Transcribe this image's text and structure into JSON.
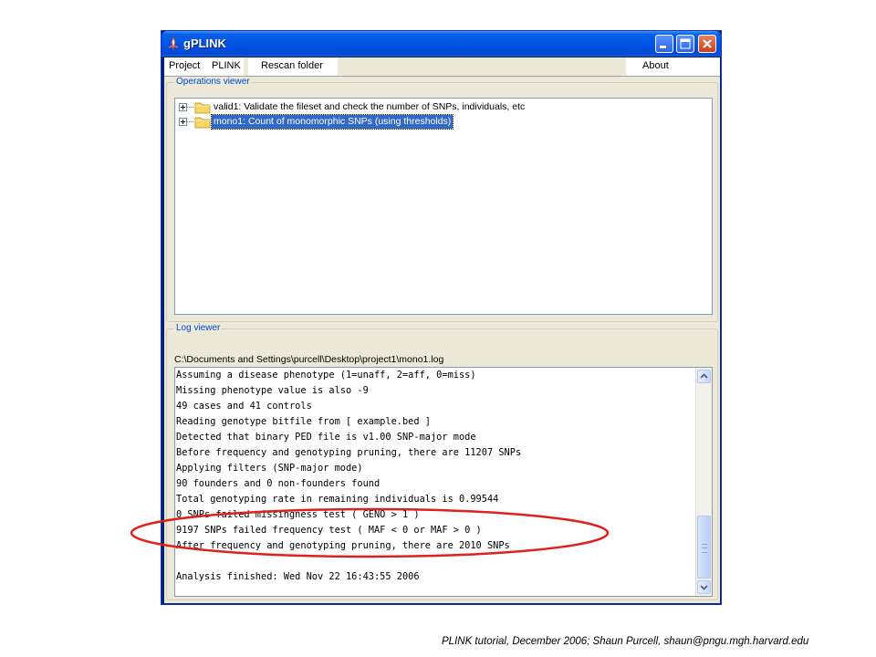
{
  "window": {
    "title": "gPLINK"
  },
  "menu": {
    "project": "Project",
    "plink": "PLINK",
    "rescan": "Rescan folder",
    "about": "About"
  },
  "operations": {
    "label": "Operations viewer",
    "items": [
      {
        "label": "valid1: Validate the fileset and check the number of SNPs, individuals, etc",
        "selected": false
      },
      {
        "label": "mono1: Count of monomorphic SNPs (using thresholds)",
        "selected": true
      }
    ]
  },
  "log": {
    "label": "Log viewer",
    "path": "C:\\Documents and Settings\\purcell\\Desktop\\project1\\mono1.log",
    "lines": [
      "Assuming a disease phenotype (1=unaff, 2=aff, 0=miss)",
      "Missing phenotype value is also -9",
      "49 cases and 41 controls",
      "Reading genotype bitfile from [ example.bed ]",
      "Detected that binary PED file is v1.00 SNP-major mode",
      "Before frequency and genotyping pruning, there are 11207 SNPs",
      "Applying filters (SNP-major mode)",
      "90 founders and 0 non-founders found",
      "Total genotyping rate in remaining individuals is 0.99544",
      "0 SNPs failed missingness test ( GENO > 1 )",
      "9197 SNPs failed frequency test ( MAF < 0 or MAF > 0 )",
      "After frequency and genotyping pruning, there are 2010 SNPs",
      "",
      "Analysis finished: Wed Nov 22 16:43:55 2006"
    ]
  },
  "colors": {
    "titlebar": "#0055e5",
    "selection": "#316ac5",
    "highlight_ellipse": "#e0201a",
    "group_label": "#0046d5"
  },
  "footer": "PLINK tutorial, December 2006; Shaun Purcell, shaun@pngu.mgh.harvard.edu"
}
